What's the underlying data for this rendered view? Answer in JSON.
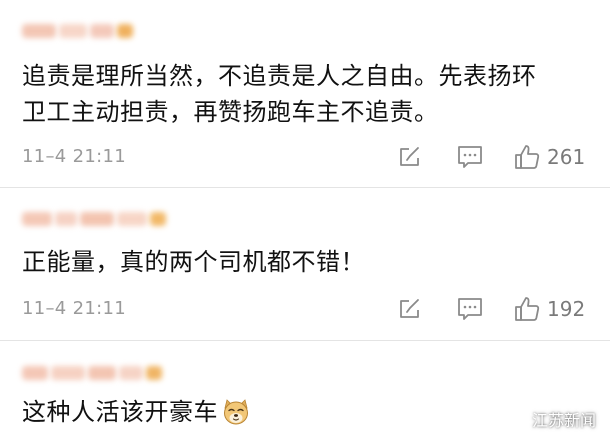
{
  "comments": [
    {
      "text_lines": [
        "追责是理所当然，不追责是人之自由。先表扬环",
        "卫工主动担责，再赞扬跑车主不追责。"
      ],
      "timestamp": "11–4 21:11",
      "likes": "261"
    },
    {
      "text_lines": [
        "正能量，真的两个司机都不错！"
      ],
      "timestamp": "11–4 21:11",
      "likes": "192"
    },
    {
      "text_lines": [
        "这种人活该开豪车"
      ],
      "emoji": "doge-emoji"
    }
  ],
  "icons": {
    "share": "share-icon",
    "comment": "comment-icon",
    "like": "like-icon"
  },
  "watermark": {
    "text": "江苏新闻"
  },
  "colors": {
    "username_blur": "#f4c8b0",
    "username_badge": "#f2b763",
    "meta_gray": "#9a9a9a",
    "icon_gray": "#8a8a8a"
  }
}
